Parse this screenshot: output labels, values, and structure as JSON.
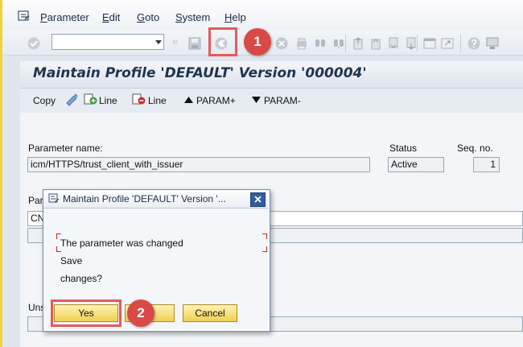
{
  "menubar": {
    "items": [
      {
        "label": "Parameter",
        "underline": "P",
        "rest": "arameter"
      },
      {
        "label": "Edit",
        "underline": "E",
        "rest": "dit"
      },
      {
        "label": "Goto",
        "underline": "G",
        "rest": "oto"
      },
      {
        "label": "System",
        "underline": "S",
        "rest": "ystem"
      },
      {
        "label": "Help",
        "underline": "H",
        "rest": "elp"
      }
    ]
  },
  "page": {
    "title": "Maintain Profile 'DEFAULT' Version '000004'"
  },
  "app_toolbar": {
    "copy": "Copy",
    "line_add": "Line",
    "line_remove": "Line",
    "param_plus": "PARAM+",
    "param_minus": "PARAM-"
  },
  "form": {
    "param_name_label": "Parameter name:",
    "param_name_value": "icm/HTTPS/trust_client_with_issuer",
    "status_label": "Status",
    "status_value": "Active",
    "seq_label": "Seq. no.",
    "seq_value": "1",
    "param_value_label_partial": "Par",
    "param_value_partial": "CN=",
    "unsub_label_partial": "Uns"
  },
  "dialog": {
    "title": "Maintain Profile 'DEFAULT' Version '...",
    "message_line1": "The parameter was changed",
    "message_line2": "Save",
    "message_line3": "changes?",
    "yes_label": "Yes",
    "no_label": "",
    "cancel_label": "Cancel"
  },
  "callouts": {
    "one": "1",
    "two": "2"
  },
  "colors": {
    "accent": "#d94a47",
    "button_yellow": "#f1cf52"
  },
  "icons": [
    "menu-icon",
    "enter-check-icon",
    "save-icon",
    "back-icon",
    "exit-icon",
    "cancel-icon",
    "print-icon",
    "find-icon",
    "find-next-icon",
    "first-page-icon",
    "prev-page-icon",
    "next-page-icon",
    "last-page-icon",
    "create-session-icon",
    "shortcut-icon",
    "help-icon",
    "layout-icon",
    "edit-icon",
    "add-line-icon",
    "remove-line-icon",
    "close-icon"
  ]
}
